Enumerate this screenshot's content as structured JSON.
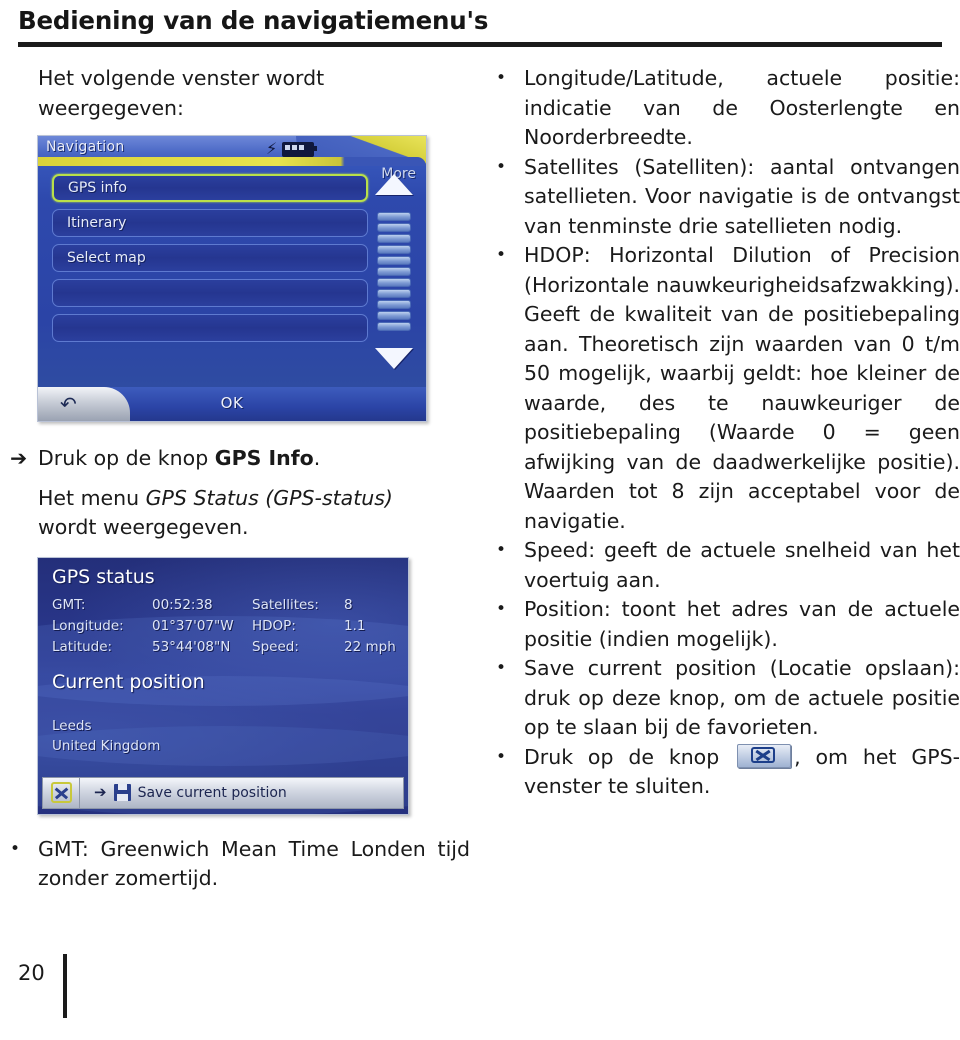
{
  "header": {
    "title": "Bediening van de navigatiemenu's"
  },
  "left_column": {
    "intro_paragraph": "Het volgende venster wordt weergegeven:",
    "nav_screenshot": {
      "title": "Navigation",
      "more_label": "More",
      "status_icons": [
        "bolt-icon",
        "battery-icon"
      ],
      "menu_items": [
        {
          "label": "GPS info",
          "selected": true
        },
        {
          "label": "Itinerary",
          "selected": false
        },
        {
          "label": "Select map",
          "selected": false
        },
        {
          "label": "",
          "selected": false
        },
        {
          "label": "",
          "selected": false
        }
      ],
      "scrollbar_segments": 11,
      "back_icon": "back-arrow-icon",
      "ok_label": "OK"
    },
    "step_arrow": "➔",
    "step_text_prefix": "Druk op de knop ",
    "step_text_bold": "GPS Info",
    "step_text_suffix": ".",
    "result_text_prefix": "Het menu ",
    "result_text_italic": "GPS Status (GPS-status)",
    "result_text_suffix": " wordt weergegeven.",
    "gps_screenshot": {
      "title": "GPS status",
      "fields": [
        {
          "label": "GMT:",
          "value": "00:52:38"
        },
        {
          "label": "Satellites:",
          "value": "8"
        },
        {
          "label": "Longitude:",
          "value": "01°37'07\"W"
        },
        {
          "label": "HDOP:",
          "value": "1.1"
        },
        {
          "label": "Latitude:",
          "value": "53°44'08\"N"
        },
        {
          "label": "Speed:",
          "value": "22 mph"
        }
      ],
      "subtitle": "Current position",
      "address_lines": [
        "Leeds",
        "United Kingdom"
      ],
      "close_icon": "close-x-icon",
      "save_icon": "floppy-disk-icon",
      "save_arrow_icon": "arrow-right-icon",
      "save_label": "Save current position"
    },
    "bullet_gmt": "GMT: Greenwich Mean Time Londen tijd zonder zomertijd."
  },
  "right_column": {
    "bullets": [
      "Longitude/Latitude, actuele positie: indicatie van de Oosterlengte en Noorderbreedte.",
      "Satellites (Satelliten): aantal ontvangen satellieten. Voor navigatie is de ontvangst van tenminste drie satellieten nodig.",
      "HDOP: Horizontal Dilution of Precision (Horizontale nauwkeurigheidsafzwakking). Geeft de kwaliteit van de positiebepaling aan. Theoretisch zijn waarden van 0 t/m 50 mogelijk, waarbij geldt: hoe kleiner de waarde, des te nauwkeuriger de positiebepaling (Waarde 0 = geen afwijking van de daadwerkelijke positie). Waarden tot 8 zijn acceptabel voor de navigatie.",
      "Speed: geeft de actuele snelheid van het voertuig aan.",
      "Position: toont het adres van de actuele positie (indien mogelijk).",
      "Save current position (Locatie opslaan): druk op deze knop, om de actuele positie op te slaan bij de favorieten."
    ],
    "close_bullet": {
      "prefix": "Druk op de knop ",
      "icon": "close-x-button-icon",
      "suffix": ", om het GPS-venster te sluiten."
    }
  },
  "footer": {
    "page_number": "20"
  },
  "colors": {
    "text": "#1a1a1a",
    "rule": "#1b1b1b",
    "nav_blue": "#2b44a6",
    "nav_accent_yellow": "#e8e34e",
    "selected_green": "#b9e04a",
    "gps_blue": "#25307e"
  }
}
